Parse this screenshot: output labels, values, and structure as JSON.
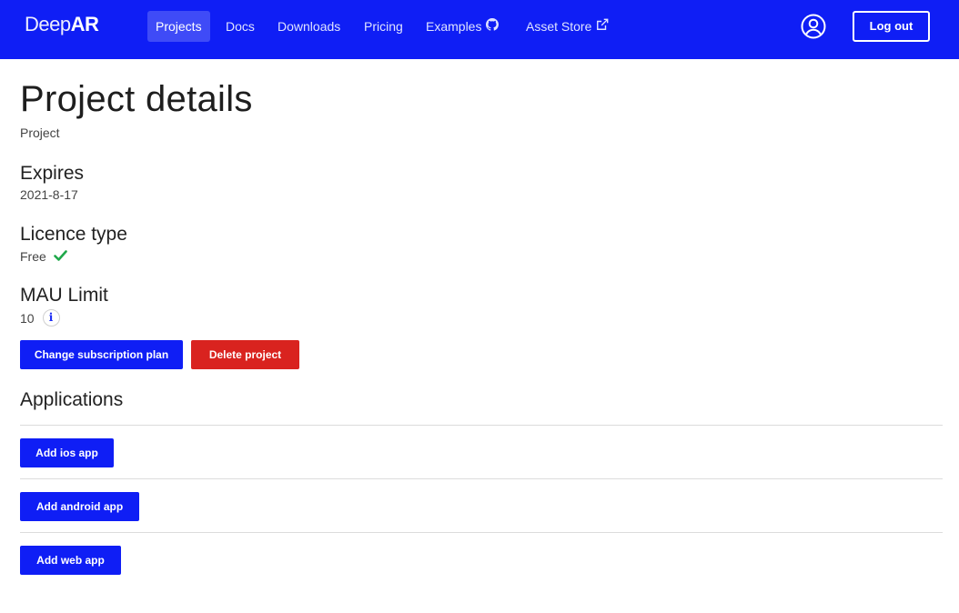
{
  "nav": {
    "logo_light": "Deep",
    "logo_bold": "AR",
    "items": [
      {
        "label": "Projects",
        "active": true
      },
      {
        "label": "Docs"
      },
      {
        "label": "Downloads"
      },
      {
        "label": "Pricing"
      },
      {
        "label": "Examples",
        "icon": "github-icon"
      },
      {
        "label": "Asset Store",
        "icon": "external-link-icon"
      }
    ],
    "avatar_icon": "user-circle-icon",
    "logout_label": "Log out",
    "brand_color": "#0f1ef5"
  },
  "page": {
    "title": "Project details",
    "subtitle": "Project"
  },
  "details": {
    "expires": {
      "heading": "Expires",
      "value": "2021-8-17"
    },
    "licence": {
      "heading": "Licence type",
      "value": "Free",
      "icon": "check-icon"
    },
    "mau": {
      "heading": "MAU Limit",
      "value": "10",
      "icon": "info-icon",
      "info_glyph": "i"
    }
  },
  "actions": {
    "change_plan": "Change subscription plan",
    "delete_project": "Delete project"
  },
  "applications": {
    "heading": "Applications",
    "buttons": [
      "Add ios app",
      "Add android app",
      "Add web app"
    ]
  },
  "colors": {
    "primary": "#0f1ef5",
    "danger": "#d9231f",
    "success": "#1fa84a"
  }
}
